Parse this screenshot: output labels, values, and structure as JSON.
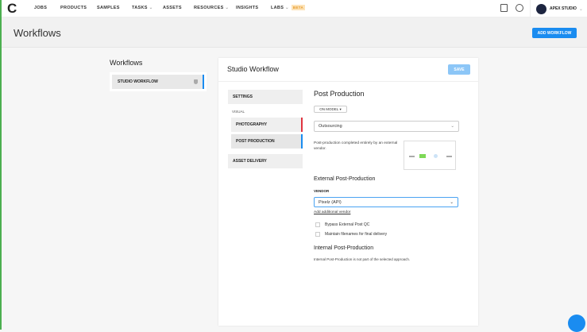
{
  "nav": {
    "items": [
      "JOBS",
      "PRODUCTS",
      "SAMPLES",
      "TASKS",
      "ASSETS",
      "RESOURCES",
      "INSIGHTS",
      "LABS"
    ],
    "beta": "BETA",
    "account": "APEX STUDIO"
  },
  "header": {
    "title": "Workflows",
    "add_button": "ADD WORKFLOW"
  },
  "left": {
    "title": "Workflows",
    "item": "STUDIO WORKFLOW"
  },
  "main": {
    "title": "Studio Workflow",
    "save": "SAVE",
    "side": {
      "settings": "SETTINGS",
      "visual": "VISUAL",
      "photography": "PHOTOGRAPHY",
      "post": "POST PRODUCTION",
      "delivery": "ASSET DELIVERY"
    },
    "section_title": "Post Production",
    "model_select": "ON MODEL",
    "approach": "Outsourcing",
    "description": "Post-production completed entirely by an external vendor.",
    "external_title": "External Post-Production",
    "vendor_label": "VENDOR",
    "vendor": "Pixelz (API)",
    "add_vendor": "Add additional vendor",
    "checks": [
      "Bypass External Post QC",
      "Maintain filenames for final delivery"
    ],
    "internal_title": "Internal Post-Production",
    "internal_text": "Internal Post-Production is not part of the selected approach."
  },
  "colors": {
    "accent": "#1a8cf0",
    "photography_bar": "#e0343f"
  }
}
